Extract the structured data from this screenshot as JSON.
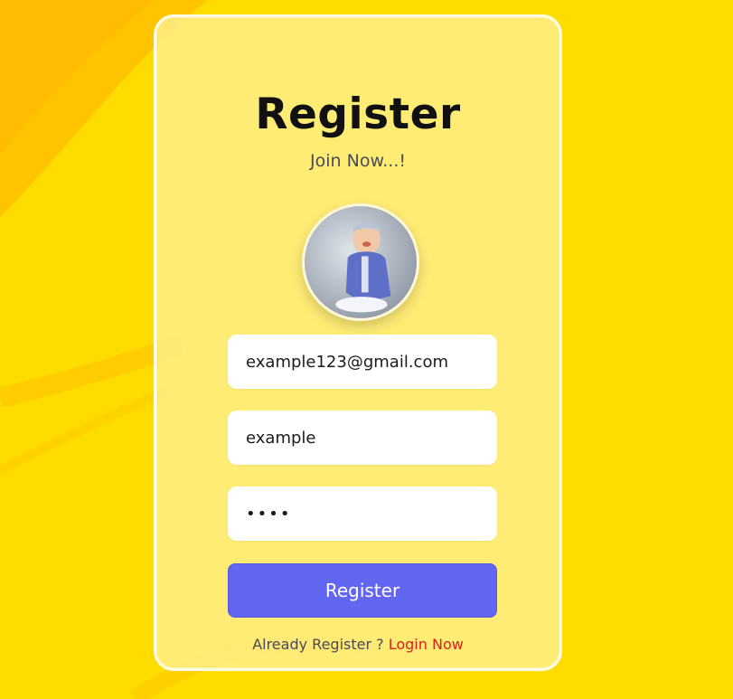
{
  "colors": {
    "background": "#ffdc00",
    "card": "#fff196",
    "button": "#6366f1",
    "link": "#e0211b"
  },
  "form": {
    "title": "Register",
    "subtitle": "Join Now...!",
    "avatar": "avatar-icon",
    "email_value": "example123@gmail.com",
    "username_value": "example",
    "password_value": "1234",
    "submit_label": "Register",
    "footer_text": "Already Register ?",
    "footer_link": "Login Now"
  }
}
